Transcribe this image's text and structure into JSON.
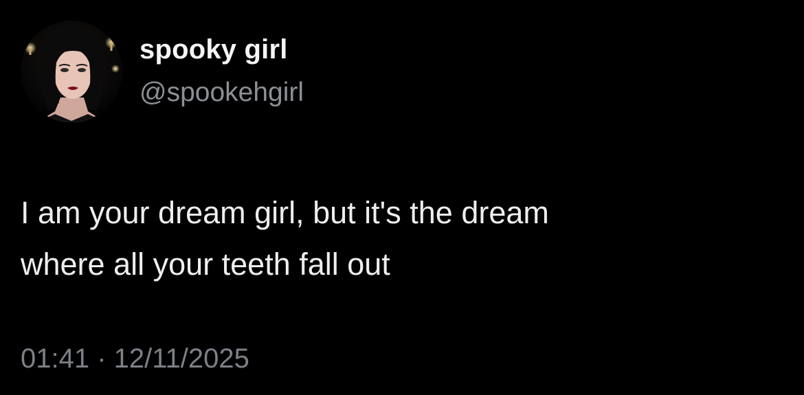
{
  "author": {
    "display_name": "spooky girl",
    "handle": "@spookehgirl",
    "avatar_icon": "profile-photo-avatar"
  },
  "tweet": {
    "lines": [
      "I am your dream girl, but it's the dream",
      "where all your teeth fall out"
    ],
    "timestamp": "01:41 · 12/11/2025"
  },
  "colors": {
    "background": "#000000",
    "text_primary": "#eeeeee",
    "text_secondary": "#8b9096"
  }
}
